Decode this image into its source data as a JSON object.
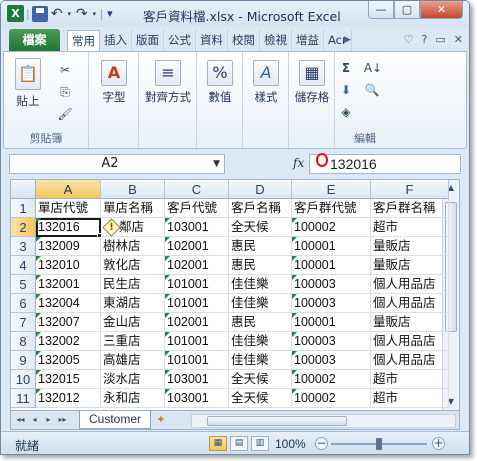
{
  "app": {
    "title": "客戶資料檔.xlsx - Microsoft Excel",
    "qat": {
      "logo": "X",
      "undo": "↶",
      "redo": "↷",
      "customize": "▾"
    },
    "window_buttons": {
      "minimize": "—",
      "restore": "▢",
      "close": "✕"
    }
  },
  "ribbon": {
    "file_tab": "檔案",
    "tabs": [
      "常用",
      "插入",
      "版面",
      "公式",
      "資料",
      "校閱",
      "檢視",
      "增益",
      "Acr"
    ],
    "right_icons": [
      "♡",
      "?",
      "▭",
      "✕"
    ],
    "groups": {
      "clipboard": {
        "paste": "貼上",
        "label": "剪貼簿"
      },
      "font": {
        "label": "字型"
      },
      "alignment": {
        "label": "對齊方式"
      },
      "number": {
        "label": "數值"
      },
      "styles": {
        "label": "樣式"
      },
      "cells": {
        "label": "儲存格"
      },
      "editing": {
        "label": "編輯"
      }
    },
    "icons": {
      "paste": "📋",
      "cut": "✂",
      "copy": "⎘",
      "brush": "🖌",
      "font": "A",
      "align": "≡",
      "number": "%",
      "styles": "A",
      "cells": "▦",
      "sum": "Σ",
      "sort": "A↓",
      "fill": "⬇",
      "find": "🔍",
      "clear": "◈"
    }
  },
  "formula_bar": {
    "name_box": "A2",
    "fx": "fx",
    "value": "132016"
  },
  "grid": {
    "columns": [
      "A",
      "B",
      "C",
      "D",
      "E",
      "F"
    ],
    "rows": [
      {
        "n": "1",
        "cells": [
          "單店代號",
          "單店名稱",
          "客戶代號",
          "客戶名稱",
          "客戶群代號",
          "客戶群名稱"
        ]
      },
      {
        "n": "2",
        "cells": [
          "132016",
          "鄰店",
          "103001",
          "全天候",
          "100002",
          "超市"
        ]
      },
      {
        "n": "3",
        "cells": [
          "132009",
          "樹林店",
          "102001",
          "惠民",
          "100001",
          "量販店"
        ]
      },
      {
        "n": "4",
        "cells": [
          "132010",
          "敦化店",
          "102001",
          "惠民",
          "100001",
          "量販店"
        ]
      },
      {
        "n": "5",
        "cells": [
          "132001",
          "民生店",
          "101001",
          "佳佳樂",
          "100003",
          "個人用品店"
        ]
      },
      {
        "n": "6",
        "cells": [
          "132004",
          "東湖店",
          "101001",
          "佳佳樂",
          "100003",
          "個人用品店"
        ]
      },
      {
        "n": "7",
        "cells": [
          "132007",
          "金山店",
          "102001",
          "惠民",
          "100001",
          "量販店"
        ]
      },
      {
        "n": "8",
        "cells": [
          "132002",
          "三重店",
          "101001",
          "佳佳樂",
          "100003",
          "個人用品店"
        ]
      },
      {
        "n": "9",
        "cells": [
          "132005",
          "高雄店",
          "101001",
          "佳佳樂",
          "100003",
          "個人用品店"
        ]
      },
      {
        "n": "10",
        "cells": [
          "132015",
          "淡水店",
          "103001",
          "全天候",
          "100002",
          "超市"
        ]
      },
      {
        "n": "11",
        "cells": [
          "132012",
          "永和店",
          "103001",
          "全天候",
          "100002",
          "超市"
        ]
      }
    ]
  },
  "sheets": {
    "active": "Customer",
    "nav": [
      "◂◂",
      "◂",
      "▸",
      "▸▸"
    ],
    "new_sheet": "✦"
  },
  "status": {
    "text": "就緒",
    "zoom": "100%",
    "zoom_out": "−",
    "zoom_in": "+",
    "zoom_level": 0.5
  },
  "colors": {
    "file_tab": "#1f7534",
    "selection": "#f4c65f",
    "error_indicator": "#1f8a3a"
  }
}
